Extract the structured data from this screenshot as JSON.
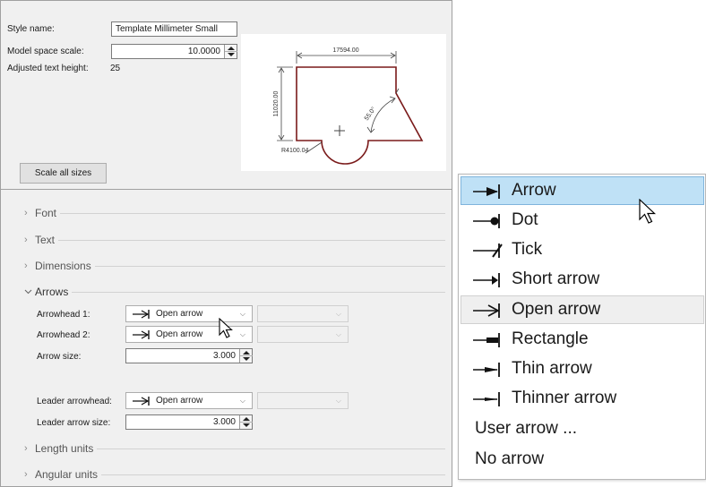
{
  "style": {
    "name_label": "Style name:",
    "name_value": "Template Millimeter Small",
    "scale_label": "Model space scale:",
    "scale_value": "10.0000",
    "text_height_label": "Adjusted text height:",
    "text_height_value": "25",
    "scale_all_button": "Scale all sizes"
  },
  "preview": {
    "width_dim": "17594.00",
    "height_dim": "11020.00",
    "angle_dim": "55.0°",
    "radius_dim": "R4100.04"
  },
  "sections": {
    "font": "Font",
    "text": "Text",
    "dimensions": "Dimensions",
    "arrows": "Arrows",
    "length_units": "Length units",
    "angular_units": "Angular units"
  },
  "arrows": {
    "arrowhead1_label": "Arrowhead 1:",
    "arrowhead1_value": "Open arrow",
    "arrowhead2_label": "Arrowhead 2:",
    "arrowhead2_value": "Open arrow",
    "arrow_size_label": "Arrow size:",
    "arrow_size_value": "3.000",
    "leader_arrowhead_label": "Leader arrowhead:",
    "leader_arrowhead_value": "Open arrow",
    "leader_size_label": "Leader arrow size:",
    "leader_size_value": "3.000"
  },
  "dropdown": {
    "options": [
      {
        "label": "Arrow",
        "icon": "filled-arrow-icon",
        "state": "hovered"
      },
      {
        "label": "Dot",
        "icon": "dot-arrow-icon",
        "state": "normal"
      },
      {
        "label": "Tick",
        "icon": "tick-arrow-icon",
        "state": "normal"
      },
      {
        "label": "Short arrow",
        "icon": "short-arrow-icon",
        "state": "normal"
      },
      {
        "label": "Open arrow",
        "icon": "open-arrow-icon",
        "state": "selected"
      },
      {
        "label": "Rectangle",
        "icon": "rectangle-arrow-icon",
        "state": "normal"
      },
      {
        "label": "Thin arrow",
        "icon": "thin-arrow-icon",
        "state": "normal"
      },
      {
        "label": "Thinner arrow",
        "icon": "thinner-arrow-icon",
        "state": "normal"
      },
      {
        "label": "User arrow ...",
        "icon": "",
        "state": "normal"
      },
      {
        "label": "No arrow",
        "icon": "",
        "state": "normal"
      }
    ]
  },
  "colors": {
    "highlight": "#bfe1f6",
    "highlight_border": "#7fb4dc",
    "shape_stroke": "#7a1a1a",
    "panel_bg": "#f0f0f0"
  }
}
